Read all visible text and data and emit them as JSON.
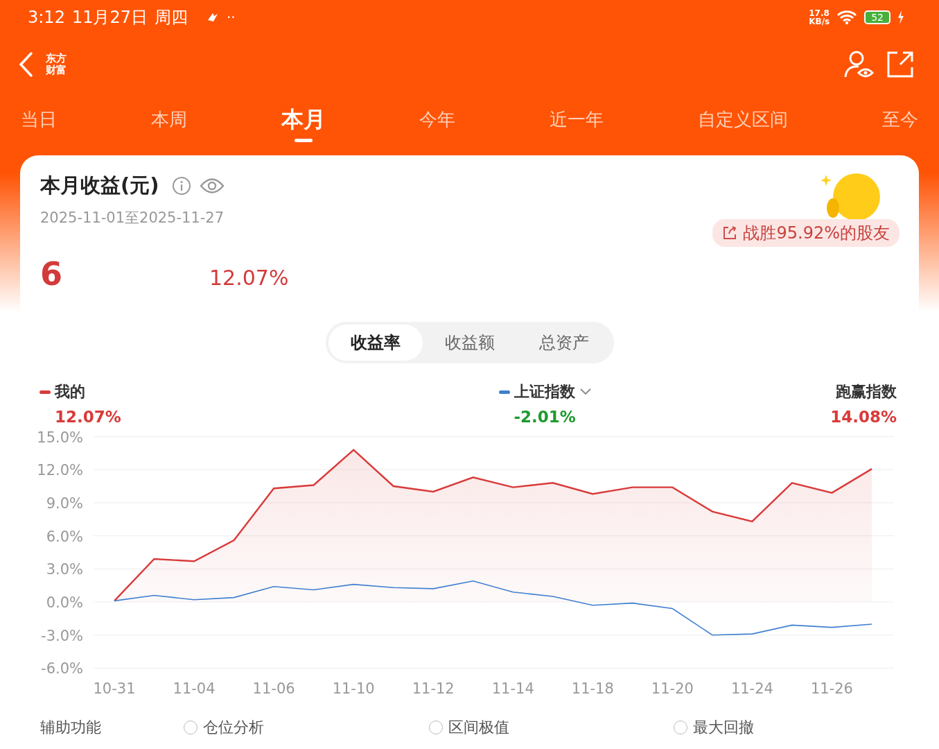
{
  "status_bar": {
    "time": "3:12",
    "date": "11月27日",
    "weekday": "周四",
    "dots": "··",
    "speed_value": "17.8",
    "speed_unit": "KB/s",
    "battery": "52"
  },
  "header": {
    "logo": "东方财富"
  },
  "tabs": [
    {
      "label": "当日",
      "selected": false
    },
    {
      "label": "本周",
      "selected": false
    },
    {
      "label": "本月",
      "selected": true
    },
    {
      "label": "今年",
      "selected": false
    },
    {
      "label": "近一年",
      "selected": false
    },
    {
      "label": "自定义区间",
      "selected": false
    },
    {
      "label": "至今",
      "selected": false
    }
  ],
  "summary": {
    "title": "本月收益(元)",
    "range": "2025-11-01至2025-11-27",
    "amount": "6",
    "rate": "12.07%",
    "badge": "战胜95.92%的股友"
  },
  "segments": [
    {
      "label": "收益率",
      "selected": true
    },
    {
      "label": "收益额",
      "selected": false
    },
    {
      "label": "总资产",
      "selected": false
    }
  ],
  "legend": [
    {
      "kind": "series",
      "value": "12.07%",
      "color": "#d93a3a"
    },
    {
      "kind": "index",
      "value": "-2.01%",
      "color": "#1f9a2e"
    },
    {
      "kind": "plain",
      "name": "跑赢指数",
      "value": "14.08%",
      "color": "#d93a3a"
    }
  ],
  "chart_data": {
    "type": "area",
    "grid": true,
    "categories": [
      "10-31",
      null,
      "11-04",
      null,
      "11-06",
      null,
      "11-10",
      null,
      "11-12",
      null,
      "11-14",
      null,
      "11-18",
      null,
      "11-20",
      null,
      "11-24",
      null,
      "11-26",
      null
    ],
    "ylim": [
      -6,
      15
    ],
    "yticks": [
      {
        "value": 15,
        "label": "15.0%"
      },
      {
        "value": 12,
        "label": "12.0%"
      },
      {
        "value": 9,
        "label": "9.0%"
      },
      {
        "value": 6,
        "label": "6.0%"
      },
      {
        "value": 3,
        "label": "3.0%"
      },
      {
        "value": 0,
        "label": "0.0%"
      },
      {
        "value": -3,
        "label": "-3.0%"
      },
      {
        "value": -6,
        "label": "-6.0%"
      }
    ],
    "series": [
      {
        "name": "我的",
        "color": "#d93a3a",
        "type": "area",
        "values": [
          0.1,
          3.9,
          3.7,
          5.6,
          10.3,
          10.6,
          13.8,
          10.5,
          10.0,
          11.3,
          10.4,
          10.8,
          9.8,
          10.4,
          10.4,
          8.2,
          7.3,
          10.8,
          9.9,
          12.07
        ]
      },
      {
        "name": "上证指数",
        "color": "#3f7fd0",
        "type": "line",
        "values": [
          0.1,
          0.6,
          0.2,
          0.4,
          1.4,
          1.1,
          1.6,
          1.3,
          1.2,
          1.9,
          0.9,
          0.5,
          -0.3,
          -0.1,
          -0.6,
          -3.0,
          -2.9,
          -2.1,
          -2.3,
          -2.01
        ]
      }
    ]
  },
  "tools": {
    "label": "辅助功能",
    "options": [
      {
        "label": "仓位分析",
        "checked": false
      },
      {
        "label": "区间极值",
        "checked": false
      },
      {
        "label": "最大回撤",
        "checked": false
      }
    ]
  }
}
